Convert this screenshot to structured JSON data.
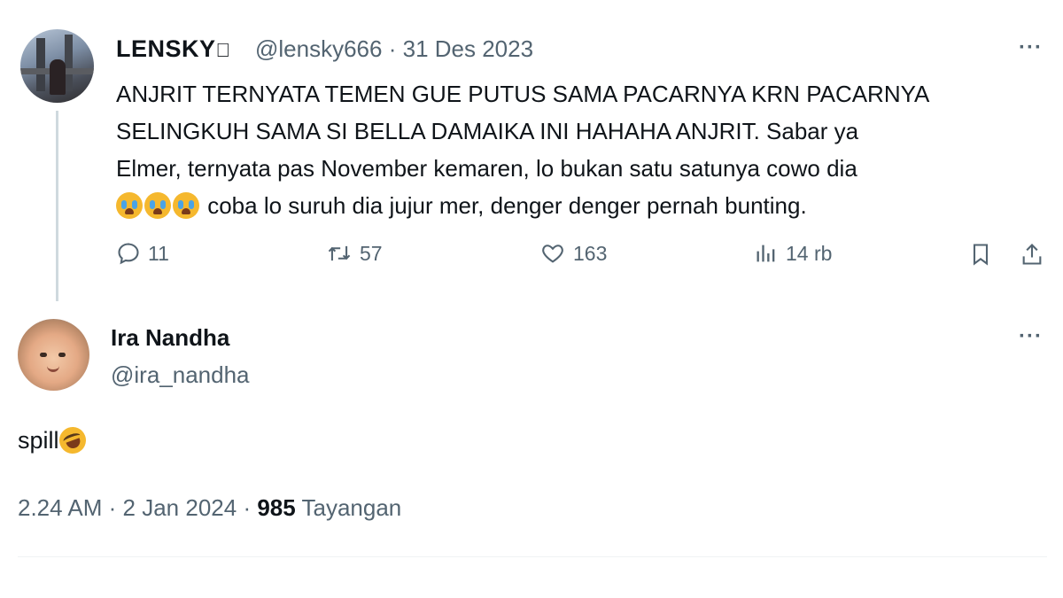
{
  "original_tweet": {
    "name": "LENSKY",
    "handle": "@lensky666",
    "date": "31 Des 2023",
    "text_lines": [
      "ANJRIT TERNYATA TEMEN GUE PUTUS SAMA PACARNYA KRN PACARNYA",
      "SELINGKUH SAMA SI BELLA DAMAIKA INI HAHAHA ANJRIT. Sabar ya",
      "Elmer, ternyata pas November kemaren, lo bukan satu satunya cowo dia",
      " coba lo suruh dia jujur mer, denger denger pernah bunting."
    ],
    "emoji_prefix": "crying-face x3",
    "stats": {
      "replies": "11",
      "reposts": "57",
      "likes": "163",
      "views": "14 rb"
    }
  },
  "reply_tweet": {
    "name": "Ira Nandha",
    "handle": "@ira_nandha",
    "text": "spill",
    "emoji": "rolling-laughing",
    "time": "2.24 AM",
    "date": "2 Jan 2024",
    "views_count": "985",
    "views_label": "Tayangan"
  },
  "more_label": "···"
}
